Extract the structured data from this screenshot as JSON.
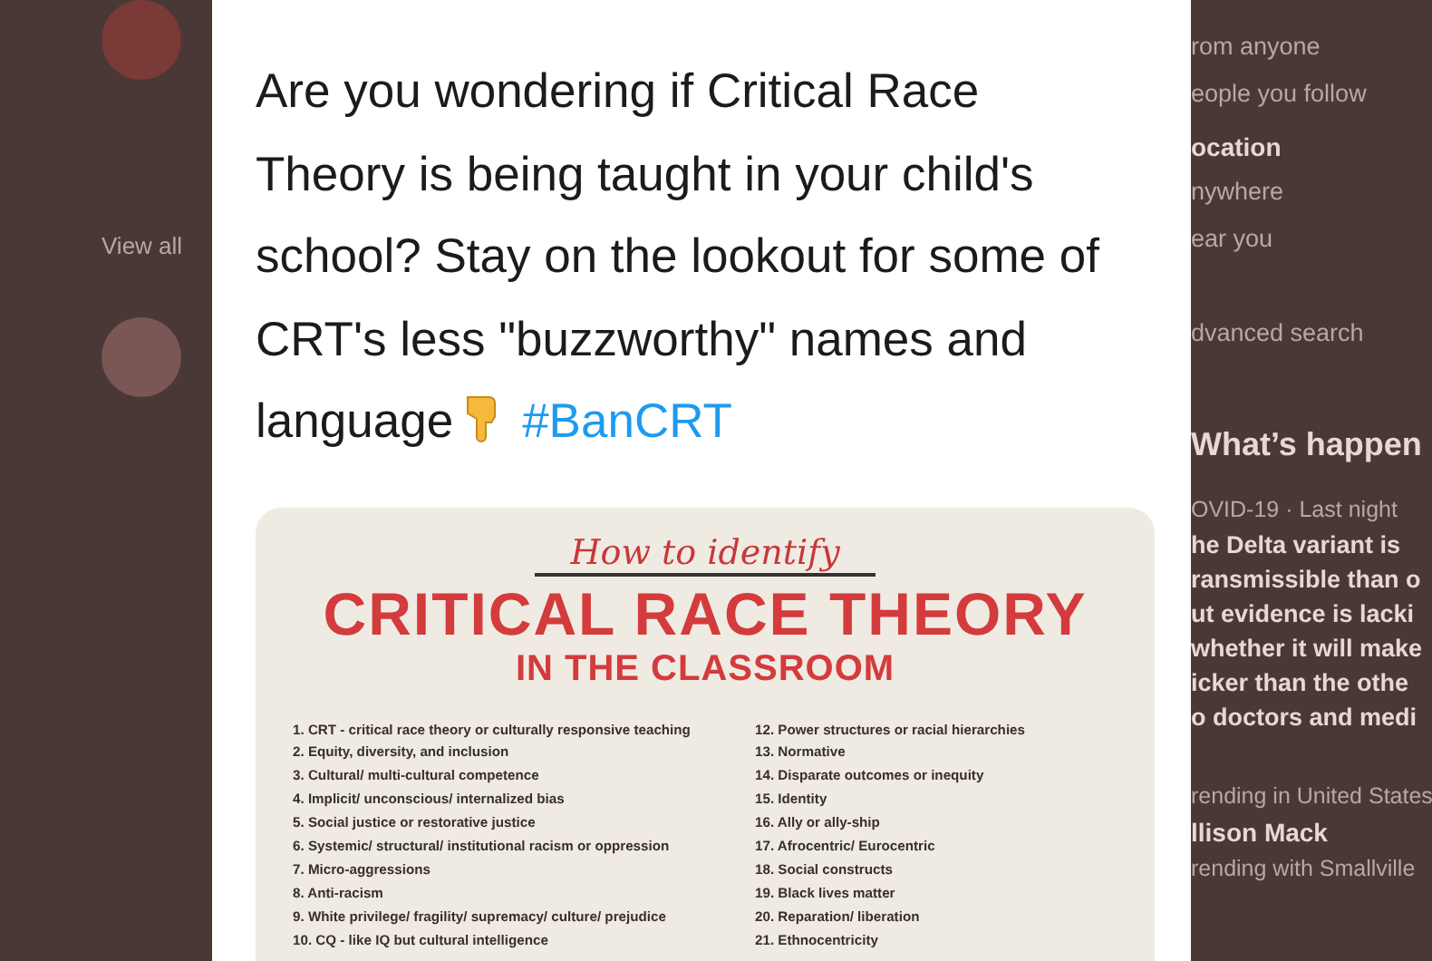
{
  "left_rail": {
    "view_all": "View all"
  },
  "tweet": {
    "text": "Are you wondering if Critical Race Theory is being taught in your child's school? Stay on the lookout for some of CRT's less \"buzzworthy\" names and language",
    "hashtag": "#BanCRT",
    "media": {
      "subtitle": "How to identify",
      "title": "CRITICAL RACE THEORY",
      "title_2": "IN THE CLASSROOM",
      "items_left": [
        "1. CRT - critical race theory or culturally responsive teaching",
        "2. Equity, diversity, and inclusion",
        "3. Cultural/ multi-cultural competence",
        "4. Implicit/ unconscious/ internalized bias",
        "5. Social justice or restorative justice",
        "6. Systemic/ structural/ institutional racism or oppression",
        "7. Micro-aggressions",
        "8. Anti-racism",
        "9. White privilege/ fragility/ supremacy/ culture/ prejudice",
        "10. CQ - like IQ but cultural intelligence"
      ],
      "items_right": [
        "12. Power structures or racial hierarchies",
        "13. Normative",
        "14. Disparate outcomes or inequity",
        "15. Identity",
        "16. Ally or ally-ship",
        "17. Afrocentric/ Eurocentric",
        "18. Social constructs",
        "19. Black lives matter",
        "20. Reparation/ liberation",
        "21. Ethnocentricity"
      ]
    }
  },
  "sidebar": {
    "people_options": [
      "rom anyone",
      "eople you follow"
    ],
    "location_heading": "ocation",
    "location_options": [
      "nywhere",
      "ear you"
    ],
    "advanced_search": "dvanced search",
    "trends_heading": "What’s happen",
    "news": {
      "meta": "OVID-19 · Last night",
      "lines": [
        "he Delta variant is",
        "ransmissible than o",
        "ut evidence is lacki",
        "whether it will make",
        "icker than the othe",
        "o doctors and medi"
      ]
    },
    "trend": {
      "meta": "rending in United States",
      "title": "llison Mack",
      "context": "rending with Smallville"
    }
  }
}
